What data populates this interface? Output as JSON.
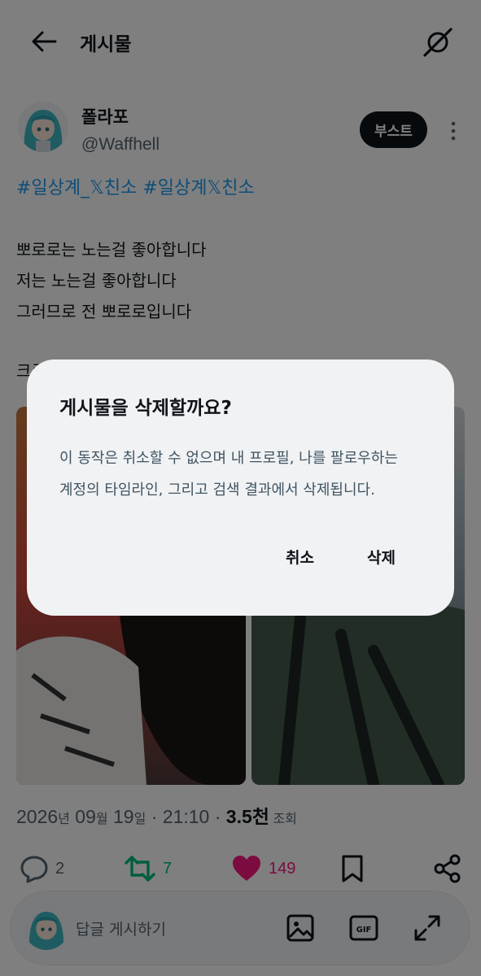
{
  "header": {
    "title": "게시물",
    "back_icon": "back-arrow-icon",
    "grok_icon": "grok-icon"
  },
  "post": {
    "author_name": "폴라포",
    "author_handle": "@Waffhell",
    "boost_label": "부스트",
    "hashtags": "#일상계_𝕏친소 #일상계𝕏친소",
    "lines": [
      "뽀로로는 노는걸 좋아합니다",
      "저는 노는걸 좋아합니다",
      "그러므로 전 뽀로로입니다"
    ],
    "partial_line": "크로",
    "timestamp_year": "2026",
    "timestamp_year_unit": "년",
    "timestamp_month": " 09",
    "timestamp_month_unit": "월",
    "timestamp_day": " 19",
    "timestamp_day_unit": "일",
    "timestamp_time": " · 21:10 · ",
    "views_num": "3.5천",
    "views_label": " 조회"
  },
  "actions": {
    "reply_count": "2",
    "repost_count": "7",
    "like_count": "149"
  },
  "reply_bar": {
    "placeholder": "답글 게시하기"
  },
  "dialog": {
    "title": "게시물을 삭제할까요?",
    "body_lines": [
      "이 동작은 취소할 수 없으며 내 프로필, 나를 팔로우하는",
      "계정의 타임라인, 그리고 검색 결과에서 삭제됩니다."
    ],
    "cancel_label": "취소",
    "delete_label": "삭제"
  },
  "colors": {
    "accent": "#1d9bf0",
    "repost": "#00ba7c",
    "like": "#f91880",
    "text": "#0f1419",
    "muted": "#536471"
  }
}
